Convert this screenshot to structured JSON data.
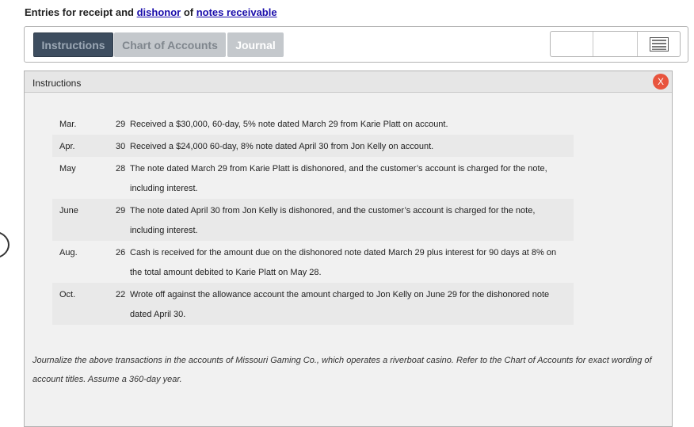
{
  "header": {
    "prefix": "Entries for receipt and ",
    "link1": "dishonor",
    "mid": " of ",
    "link2": "notes receivable"
  },
  "tabs": {
    "instructions": "Instructions",
    "chart": "Chart of Accounts",
    "journal": "Journal"
  },
  "panel": {
    "title": "Instructions",
    "close_label": "X"
  },
  "entries": [
    {
      "month": "Mar.",
      "day": "29",
      "text": "Received a $30,000, 60-day, 5% note dated March 29 from Karie Platt on account."
    },
    {
      "month": "Apr.",
      "day": "30",
      "text": "Received a $24,000 60-day, 8% note dated April 30 from Jon Kelly on account."
    },
    {
      "month": "May",
      "day": "28",
      "text": "The note dated March 29 from Karie Platt is dishonored, and the customer’s account is charged for the note, including interest."
    },
    {
      "month": "June",
      "day": "29",
      "text": "The note dated April 30 from Jon Kelly is dishonored, and the customer’s account is charged for the note, including interest."
    },
    {
      "month": "Aug.",
      "day": "26",
      "text": "Cash is received for the amount due on the dishonored note dated March 29 plus interest for 90 days at 8% on the total amount debited to Karie Platt on May 28."
    },
    {
      "month": "Oct.",
      "day": "22",
      "text": "Wrote off against the allowance account the amount charged to Jon Kelly on June 29 for the dishonored note dated April 30."
    }
  ],
  "footnote": "Journalize the above transactions in the accounts of Missouri Gaming Co., which operates a riverboat casino. Refer to the Chart of Accounts for exact wording of account titles. Assume a 360-day year."
}
